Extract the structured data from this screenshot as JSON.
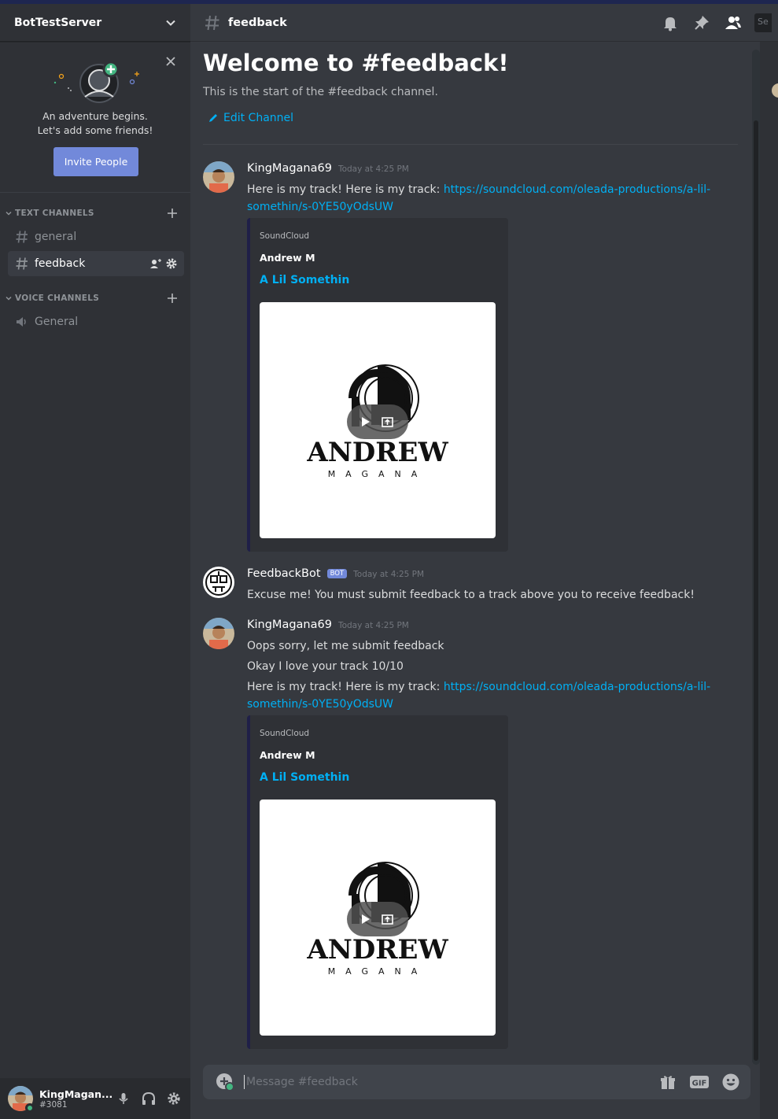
{
  "server": {
    "name": "BotTestServer"
  },
  "invite": {
    "line1": "An adventure begins.",
    "line2": "Let's add some friends!",
    "button": "Invite People"
  },
  "categories": {
    "text": "TEXT CHANNELS",
    "voice": "VOICE CHANNELS"
  },
  "channels": {
    "text": [
      {
        "name": "general"
      },
      {
        "name": "feedback"
      }
    ],
    "voice": [
      {
        "name": "General"
      }
    ]
  },
  "user": {
    "name": "KingMagan...",
    "tag": "#3081"
  },
  "header": {
    "channel": "feedback",
    "search_stub": "Se"
  },
  "welcome": {
    "title": "Welcome to #feedback!",
    "subtitle": "This is the start of the #feedback channel.",
    "edit": "Edit Channel"
  },
  "messages": [
    {
      "author": "KingMagana69",
      "timestamp": "Today at 4:25 PM",
      "lines": [
        "Here is my track! Here is my track: "
      ],
      "link_part1": "https://soundcloud.com/oleada-productions/a-lil-",
      "link_part2": "somethin/s-0YE50yOdsUW",
      "embed": {
        "provider": "SoundCloud",
        "author": "Andrew M",
        "title": "A Lil Somethin",
        "image_text": "ANDREW",
        "image_sub": "MAGANA"
      }
    },
    {
      "author": "FeedbackBot",
      "badge": "BOT",
      "timestamp": "Today at 4:25 PM",
      "lines": [
        "Excuse me! You must submit feedback to a track above you to receive feedback!"
      ]
    },
    {
      "author": "KingMagana69",
      "timestamp": "Today at 4:25 PM",
      "lines": [
        "Oops sorry, let me submit feedback",
        "Okay I love your track 10/10",
        "Here is my track! Here is my track: "
      ],
      "link_part1": "https://soundcloud.com/oleada-productions/a-lil-",
      "link_part2": "somethin/s-0YE50yOdsUW",
      "embed": {
        "provider": "SoundCloud",
        "author": "Andrew M",
        "title": "A Lil Somethin",
        "image_text": "ANDREW",
        "image_sub": "MAGANA"
      }
    }
  ],
  "composer": {
    "placeholder": "Message #feedback",
    "gif_label": "GIF"
  },
  "colors": {
    "accent": "#7289da",
    "link": "#00b0f4",
    "online": "#43b581",
    "background": "#36393f",
    "sidebar": "#2f3136"
  }
}
